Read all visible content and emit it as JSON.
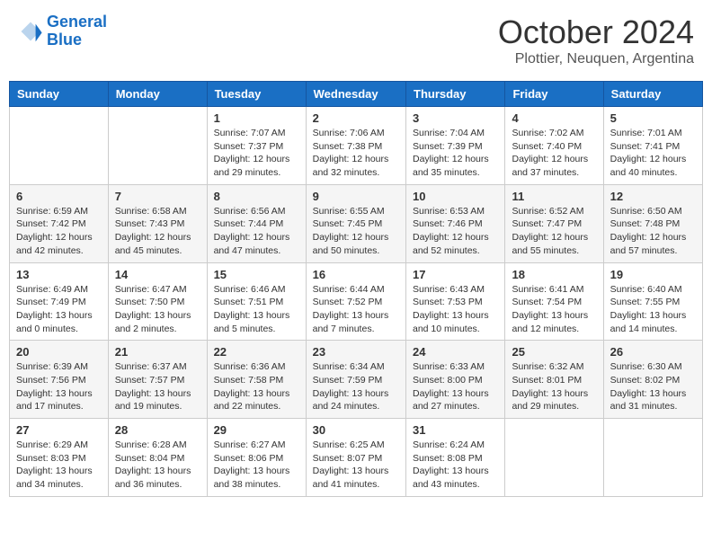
{
  "header": {
    "logo_general": "General",
    "logo_blue": "Blue",
    "month_title": "October 2024",
    "subtitle": "Plottier, Neuquen, Argentina"
  },
  "weekdays": [
    "Sunday",
    "Monday",
    "Tuesday",
    "Wednesday",
    "Thursday",
    "Friday",
    "Saturday"
  ],
  "weeks": [
    [
      {
        "day": "",
        "info": ""
      },
      {
        "day": "",
        "info": ""
      },
      {
        "day": "1",
        "info": "Sunrise: 7:07 AM\nSunset: 7:37 PM\nDaylight: 12 hours and 29 minutes."
      },
      {
        "day": "2",
        "info": "Sunrise: 7:06 AM\nSunset: 7:38 PM\nDaylight: 12 hours and 32 minutes."
      },
      {
        "day": "3",
        "info": "Sunrise: 7:04 AM\nSunset: 7:39 PM\nDaylight: 12 hours and 35 minutes."
      },
      {
        "day": "4",
        "info": "Sunrise: 7:02 AM\nSunset: 7:40 PM\nDaylight: 12 hours and 37 minutes."
      },
      {
        "day": "5",
        "info": "Sunrise: 7:01 AM\nSunset: 7:41 PM\nDaylight: 12 hours and 40 minutes."
      }
    ],
    [
      {
        "day": "6",
        "info": "Sunrise: 6:59 AM\nSunset: 7:42 PM\nDaylight: 12 hours and 42 minutes."
      },
      {
        "day": "7",
        "info": "Sunrise: 6:58 AM\nSunset: 7:43 PM\nDaylight: 12 hours and 45 minutes."
      },
      {
        "day": "8",
        "info": "Sunrise: 6:56 AM\nSunset: 7:44 PM\nDaylight: 12 hours and 47 minutes."
      },
      {
        "day": "9",
        "info": "Sunrise: 6:55 AM\nSunset: 7:45 PM\nDaylight: 12 hours and 50 minutes."
      },
      {
        "day": "10",
        "info": "Sunrise: 6:53 AM\nSunset: 7:46 PM\nDaylight: 12 hours and 52 minutes."
      },
      {
        "day": "11",
        "info": "Sunrise: 6:52 AM\nSunset: 7:47 PM\nDaylight: 12 hours and 55 minutes."
      },
      {
        "day": "12",
        "info": "Sunrise: 6:50 AM\nSunset: 7:48 PM\nDaylight: 12 hours and 57 minutes."
      }
    ],
    [
      {
        "day": "13",
        "info": "Sunrise: 6:49 AM\nSunset: 7:49 PM\nDaylight: 13 hours and 0 minutes."
      },
      {
        "day": "14",
        "info": "Sunrise: 6:47 AM\nSunset: 7:50 PM\nDaylight: 13 hours and 2 minutes."
      },
      {
        "day": "15",
        "info": "Sunrise: 6:46 AM\nSunset: 7:51 PM\nDaylight: 13 hours and 5 minutes."
      },
      {
        "day": "16",
        "info": "Sunrise: 6:44 AM\nSunset: 7:52 PM\nDaylight: 13 hours and 7 minutes."
      },
      {
        "day": "17",
        "info": "Sunrise: 6:43 AM\nSunset: 7:53 PM\nDaylight: 13 hours and 10 minutes."
      },
      {
        "day": "18",
        "info": "Sunrise: 6:41 AM\nSunset: 7:54 PM\nDaylight: 13 hours and 12 minutes."
      },
      {
        "day": "19",
        "info": "Sunrise: 6:40 AM\nSunset: 7:55 PM\nDaylight: 13 hours and 14 minutes."
      }
    ],
    [
      {
        "day": "20",
        "info": "Sunrise: 6:39 AM\nSunset: 7:56 PM\nDaylight: 13 hours and 17 minutes."
      },
      {
        "day": "21",
        "info": "Sunrise: 6:37 AM\nSunset: 7:57 PM\nDaylight: 13 hours and 19 minutes."
      },
      {
        "day": "22",
        "info": "Sunrise: 6:36 AM\nSunset: 7:58 PM\nDaylight: 13 hours and 22 minutes."
      },
      {
        "day": "23",
        "info": "Sunrise: 6:34 AM\nSunset: 7:59 PM\nDaylight: 13 hours and 24 minutes."
      },
      {
        "day": "24",
        "info": "Sunrise: 6:33 AM\nSunset: 8:00 PM\nDaylight: 13 hours and 27 minutes."
      },
      {
        "day": "25",
        "info": "Sunrise: 6:32 AM\nSunset: 8:01 PM\nDaylight: 13 hours and 29 minutes."
      },
      {
        "day": "26",
        "info": "Sunrise: 6:30 AM\nSunset: 8:02 PM\nDaylight: 13 hours and 31 minutes."
      }
    ],
    [
      {
        "day": "27",
        "info": "Sunrise: 6:29 AM\nSunset: 8:03 PM\nDaylight: 13 hours and 34 minutes."
      },
      {
        "day": "28",
        "info": "Sunrise: 6:28 AM\nSunset: 8:04 PM\nDaylight: 13 hours and 36 minutes."
      },
      {
        "day": "29",
        "info": "Sunrise: 6:27 AM\nSunset: 8:06 PM\nDaylight: 13 hours and 38 minutes."
      },
      {
        "day": "30",
        "info": "Sunrise: 6:25 AM\nSunset: 8:07 PM\nDaylight: 13 hours and 41 minutes."
      },
      {
        "day": "31",
        "info": "Sunrise: 6:24 AM\nSunset: 8:08 PM\nDaylight: 13 hours and 43 minutes."
      },
      {
        "day": "",
        "info": ""
      },
      {
        "day": "",
        "info": ""
      }
    ]
  ]
}
